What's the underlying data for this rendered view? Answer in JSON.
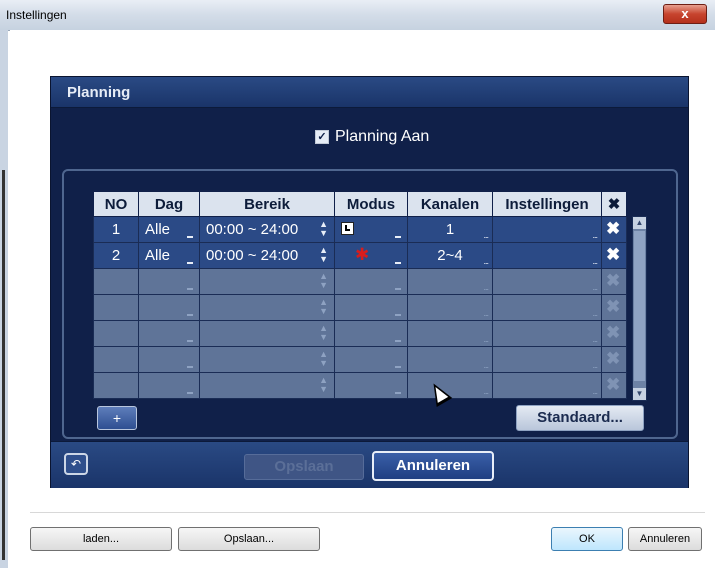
{
  "window": {
    "title": "Instellingen",
    "close_glyph": "x"
  },
  "panel": {
    "title": "Planning",
    "schedule_toggle": {
      "label": "Planning Aan",
      "checked": true
    },
    "table": {
      "headers": [
        "NO",
        "Dag",
        "Bereik",
        "Modus",
        "Kanalen",
        "Instellingen"
      ],
      "delete_header_glyph": "✖",
      "rows": [
        {
          "no": "1",
          "day": "Alle",
          "range": "00:00 ~ 24:00",
          "mode": "record-icon",
          "channels": "1",
          "settings": ""
        },
        {
          "no": "2",
          "day": "Alle",
          "range": "00:00 ~ 24:00",
          "mode": "alarm-icon",
          "channels": "2~4",
          "settings": ""
        }
      ],
      "empty_rows": 5
    },
    "add_button": "+",
    "default_button": "Standaard...",
    "footer": {
      "back_glyph": "↶",
      "save_button": "Opslaan",
      "cancel_button": "Annuleren"
    }
  },
  "bottom_bar": {
    "load_button": "laden...",
    "save_button": "Opslaan...",
    "ok_button": "OK",
    "cancel_button": "Annuleren"
  },
  "colors": {
    "panel_bg": "#102049",
    "active_row": "#2b4a86",
    "empty_row": "#5f7498",
    "header_cell": "#dbe3ee"
  }
}
